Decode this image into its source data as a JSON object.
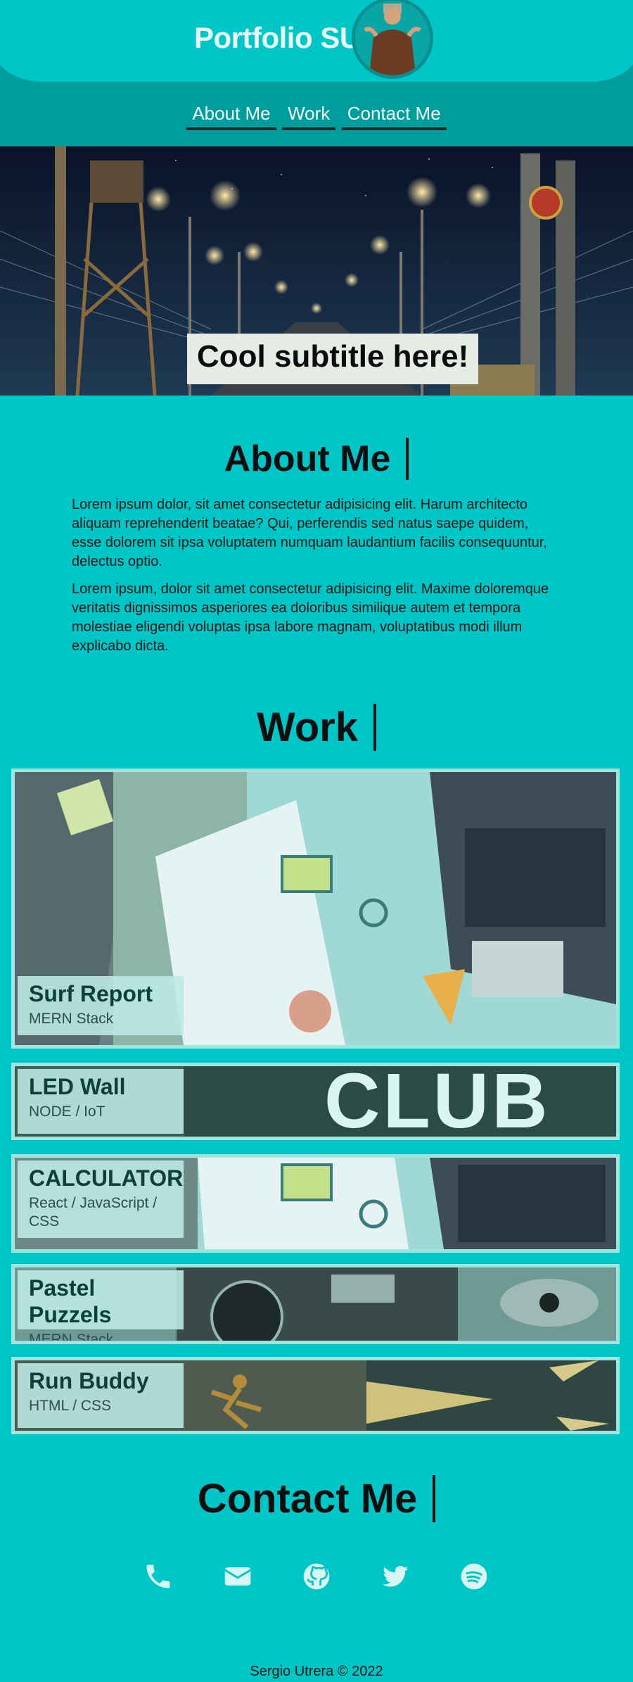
{
  "header": {
    "brand": "Portfolio SU",
    "nav": [
      "About Me",
      "Work",
      "Contact Me"
    ]
  },
  "hero": {
    "subtitle": "Cool subtitle here!"
  },
  "about": {
    "title": "About Me",
    "paragraphs": [
      "Lorem ipsum dolor, sit amet consectetur adipisicing elit. Harum architecto aliquam reprehenderit beatae? Qui, perferendis sed natus saepe quidem, esse dolorem sit ipsa voluptatem numquam laudantium facilis consequuntur, delectus optio.",
      "Lorem ipsum, dolor sit amet consectetur adipisicing elit. Maxime doloremque veritatis dignissimos asperiores ea doloribus similique autem et tempora molestiae eligendi voluptas ipsa labore magnam, voluptatibus modi illum explicabo dicta."
    ]
  },
  "work": {
    "title": "Work",
    "projects": [
      {
        "title": "Surf Report",
        "stack": "MERN Stack"
      },
      {
        "title": "LED Wall",
        "stack": "NODE / IoT",
        "image_text": "CLUB"
      },
      {
        "title": "CALCULATOR",
        "stack": "React / JavaScript / CSS"
      },
      {
        "title": "Pastel Puzzels",
        "stack": "MERN Stack"
      },
      {
        "title": "Run Buddy",
        "stack": "HTML / CSS"
      }
    ]
  },
  "contact": {
    "title": "Contact Me",
    "icons": [
      "phone-icon",
      "email-icon",
      "github-icon",
      "twitter-icon",
      "spotify-icon"
    ]
  },
  "footer": {
    "text": "Sergio Utrera © 2022"
  },
  "colors": {
    "background": "#00c7c7",
    "header_band": "#009d9d",
    "card_border": "#9fe4df"
  }
}
